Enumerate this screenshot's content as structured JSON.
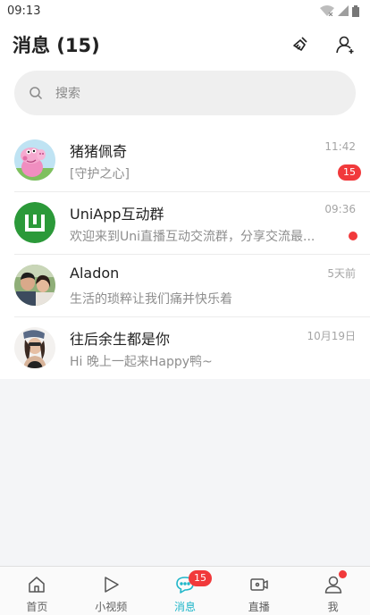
{
  "status_bar": {
    "time": "09:13"
  },
  "header": {
    "title": "消息 (15)",
    "clear_icon": "broom-icon",
    "contacts_icon": "add-friend-icon"
  },
  "search": {
    "placeholder": "搜索"
  },
  "conversations": [
    {
      "name": "猪猪佩奇",
      "preview": "[守护之心]",
      "time": "11:42",
      "unread": "15",
      "avatar": "peppa-pig-avatar"
    },
    {
      "name": "UniApp互动群",
      "preview": "欢迎来到Uni直播互动交流群，分享交流最...",
      "time": "09:36",
      "unread_dot": true,
      "avatar": "uniapp-logo-avatar"
    },
    {
      "name": "Aladon",
      "preview": "生活的琐粹让我们痛并快乐着",
      "time": "5天前",
      "avatar": "couple-photo-avatar"
    },
    {
      "name": "往后余生都是你",
      "preview": "Hi 晚上一起来Happy鸭~",
      "time": "10月19日",
      "avatar": "girl-photo-avatar"
    }
  ],
  "tabbar": {
    "tabs": [
      {
        "label": "首页",
        "icon": "home-icon"
      },
      {
        "label": "小视频",
        "icon": "play-icon"
      },
      {
        "label": "消息",
        "icon": "chat-icon",
        "badge": "15",
        "active": true
      },
      {
        "label": "直播",
        "icon": "live-camera-icon"
      },
      {
        "label": "我",
        "icon": "user-icon",
        "dot": true
      }
    ]
  },
  "colors": {
    "accent": "#1fb6c9",
    "badge": "#f1393b",
    "search_bg": "#efefef",
    "uniapp_green": "#2b9939"
  }
}
